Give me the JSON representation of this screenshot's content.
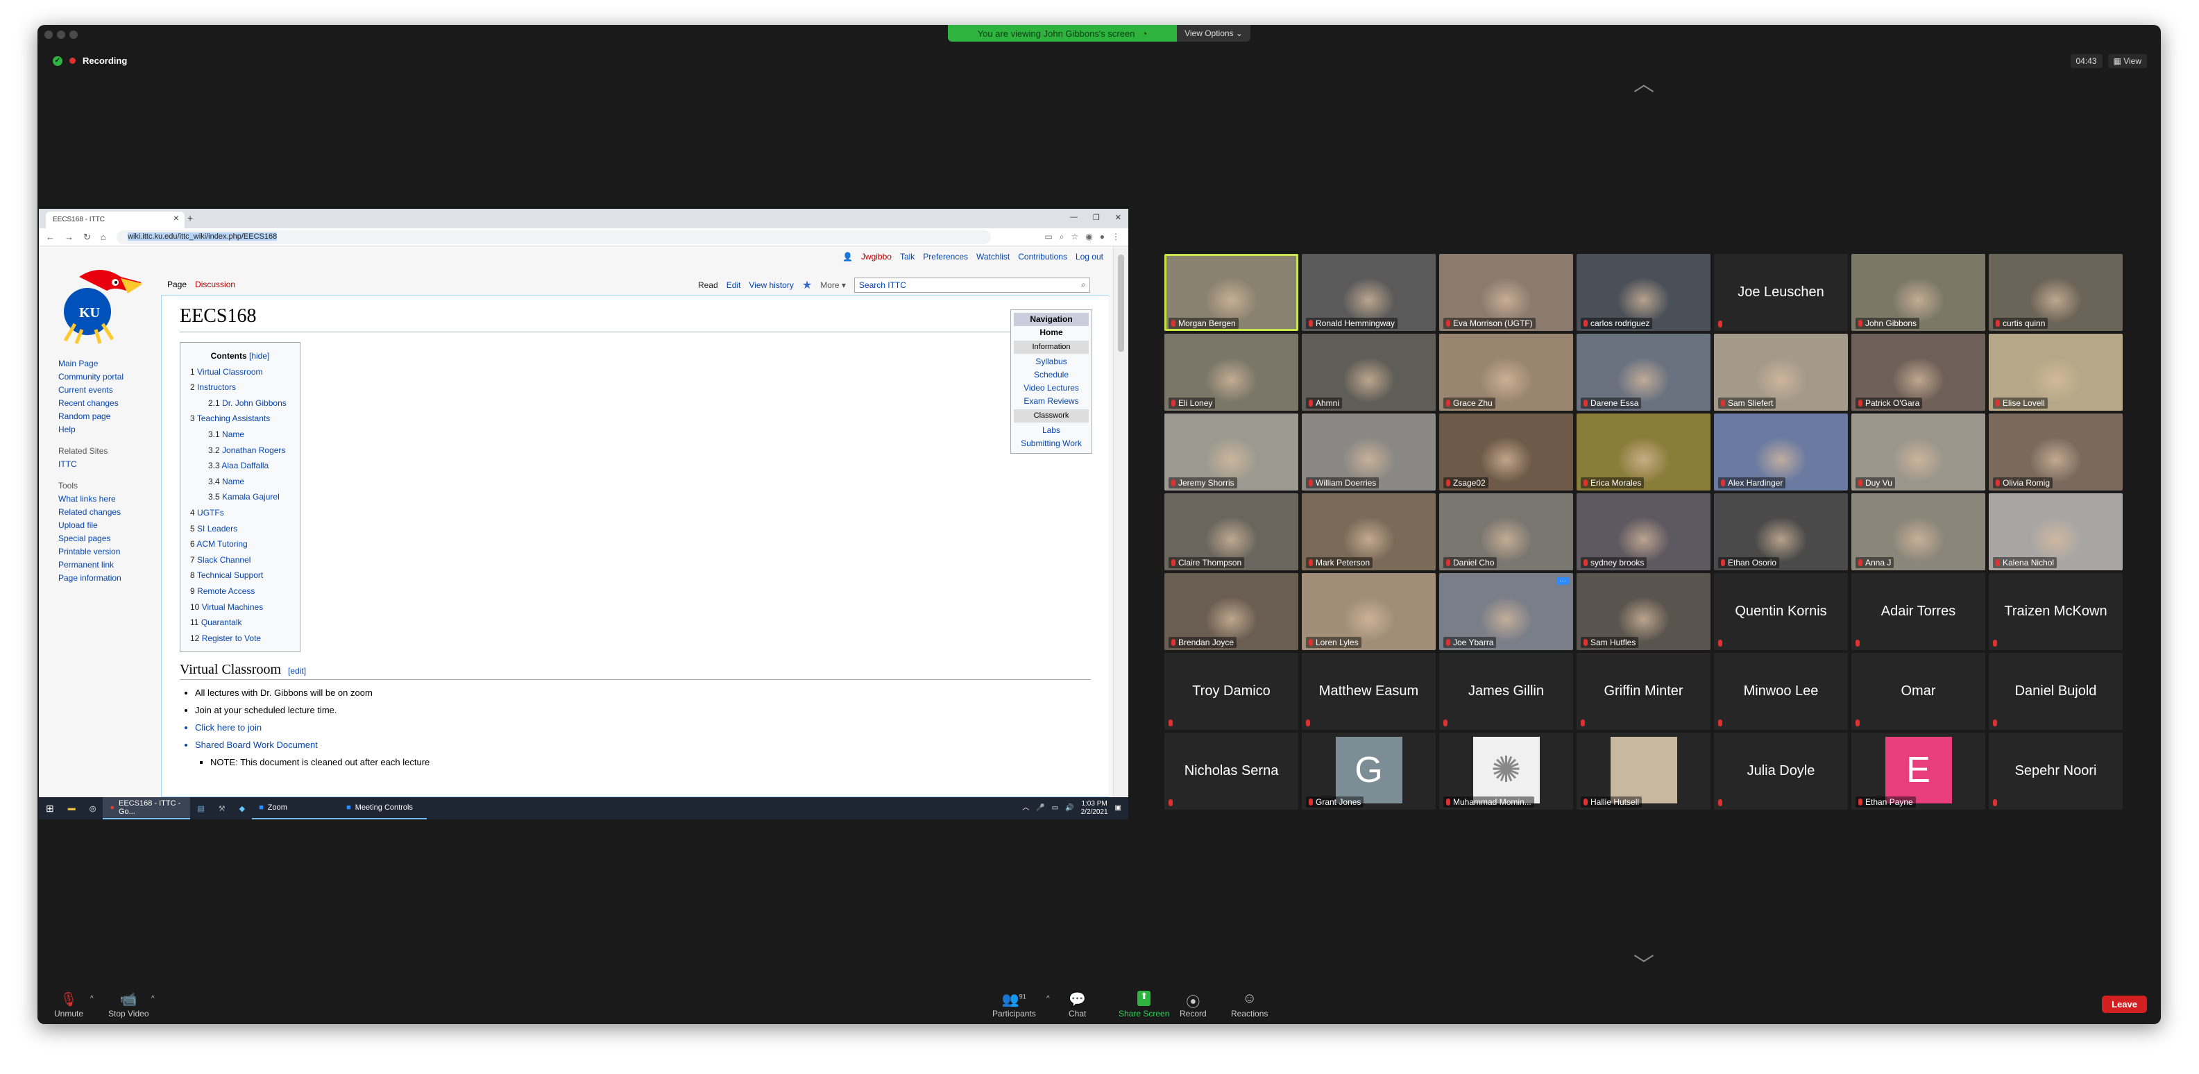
{
  "banner": {
    "viewing": "You are viewing John Gibbons's screen",
    "view_options": "View Options ⌄"
  },
  "recording": "Recording",
  "timer": "04:43",
  "view_btn": "View",
  "browser": {
    "tab_title": "EECS168 - ITTC",
    "url_display": "wiki.ittc.ku.edu/ittc_wiki/index.php/EECS168"
  },
  "wiki": {
    "personal": [
      "Jwgibbo",
      "Talk",
      "Preferences",
      "Watchlist",
      "Contributions",
      "Log out"
    ],
    "tabs_left": [
      "Page",
      "Discussion"
    ],
    "tabs_right": [
      "Read",
      "Edit",
      "View history",
      "More ▾"
    ],
    "search_placeholder": "Search ITTC",
    "sidebar": {
      "main": [
        "Main Page",
        "Community portal",
        "Current events",
        "Recent changes",
        "Random page",
        "Help"
      ],
      "related_heading": "Related Sites",
      "related": [
        "ITTC"
      ],
      "tools_heading": "Tools",
      "tools": [
        "What links here",
        "Related changes",
        "Upload file",
        "Special pages",
        "Printable version",
        "Permanent link",
        "Page information"
      ]
    },
    "title": "EECS168",
    "toc_title": "Contents",
    "toc_hide": "[hide]",
    "toc": [
      {
        "n": "1",
        "t": "Virtual Classroom",
        "sub": false
      },
      {
        "n": "2",
        "t": "Instructors",
        "sub": false
      },
      {
        "n": "2.1",
        "t": "Dr. John Gibbons",
        "sub": true
      },
      {
        "n": "3",
        "t": "Teaching Assistants",
        "sub": false
      },
      {
        "n": "3.1",
        "t": "Name",
        "sub": true
      },
      {
        "n": "3.2",
        "t": "Jonathan Rogers",
        "sub": true
      },
      {
        "n": "3.3",
        "t": "Alaa Daffalla",
        "sub": true
      },
      {
        "n": "3.4",
        "t": "Name",
        "sub": true
      },
      {
        "n": "3.5",
        "t": "Kamala Gajurel",
        "sub": true
      },
      {
        "n": "4",
        "t": "UGTFs",
        "sub": false
      },
      {
        "n": "5",
        "t": "SI Leaders",
        "sub": false
      },
      {
        "n": "6",
        "t": "ACM Tutoring",
        "sub": false
      },
      {
        "n": "7",
        "t": "Slack Channel",
        "sub": false
      },
      {
        "n": "8",
        "t": "Technical Support",
        "sub": false
      },
      {
        "n": "9",
        "t": "Remote Access",
        "sub": false
      },
      {
        "n": "10",
        "t": "Virtual Machines",
        "sub": false
      },
      {
        "n": "11",
        "t": "Quarantalk",
        "sub": false
      },
      {
        "n": "12",
        "t": "Register to Vote",
        "sub": false
      }
    ],
    "navbox": {
      "title": "Navigation",
      "home": "Home",
      "info": "Information",
      "links1": [
        "Syllabus",
        "Schedule",
        "Video Lectures",
        "Exam Reviews"
      ],
      "classwork": "Classwork",
      "links2": [
        "Labs",
        "Submitting Work"
      ]
    },
    "section_title": "Virtual Classroom",
    "section_edit": "[edit]",
    "bullets": [
      {
        "t": "All lectures with Dr. Gibbons will be on zoom",
        "link": false
      },
      {
        "t": "Join at your scheduled lecture time.",
        "link": false
      },
      {
        "t": "Click here to join",
        "link": true
      },
      {
        "t": "Shared Board Work Document",
        "link": true
      }
    ],
    "note": "NOTE: This document is cleaned out after each lecture"
  },
  "taskbar": {
    "chrome_task": "EECS168 - ITTC - Go...",
    "zoom_task": "Zoom",
    "meeting_task": "Meeting Controls",
    "time": "1:03 PM",
    "date": "2/2/2021"
  },
  "participants_grid": [
    {
      "name": "Morgan Bergen",
      "type": "video",
      "speaking": true,
      "bg": "#8a8270"
    },
    {
      "name": "Ronald Hemmingway",
      "type": "video",
      "bg": "#5a5a5a"
    },
    {
      "name": "Eva Morrison (UGTF)",
      "type": "video",
      "bg": "#8b7a6e"
    },
    {
      "name": "carlos rodriguez",
      "type": "video",
      "bg": "#4a5058"
    },
    {
      "name": "Joe Leuschen",
      "type": "name"
    },
    {
      "name": "John Gibbons",
      "type": "video",
      "bg": "#7b7868"
    },
    {
      "name": "curtis quinn",
      "type": "video",
      "bg": "#6b6458"
    },
    {
      "name": "Eli Loney",
      "type": "video",
      "bg": "#7a7668"
    },
    {
      "name": "Ahmni",
      "type": "video",
      "bg": "#5f5d57"
    },
    {
      "name": "Grace Zhu",
      "type": "video",
      "bg": "#9a8670"
    },
    {
      "name": "Darene Essa",
      "type": "video",
      "bg": "#6a7280"
    },
    {
      "name": "Sam Sliefert",
      "type": "video",
      "bg": "#a39a8a"
    },
    {
      "name": "Patrick O'Gara",
      "type": "video",
      "bg": "#6e6058"
    },
    {
      "name": "Elise Lovell",
      "type": "video",
      "bg": "#b5a888"
    },
    {
      "name": "Jeremy Shorris",
      "type": "video",
      "bg": "#9c9a90"
    },
    {
      "name": "William Doerries",
      "type": "video",
      "bg": "#8a8884"
    },
    {
      "name": "Zsage02",
      "type": "video",
      "bg": "#6e5a48"
    },
    {
      "name": "Erica Morales",
      "type": "video",
      "bg": "#8a7d3a"
    },
    {
      "name": "Alex Hardinger",
      "type": "video",
      "bg": "#6a7aa0"
    },
    {
      "name": "Duy Vu",
      "type": "video",
      "bg": "#9a968c"
    },
    {
      "name": "Olivia Romig",
      "type": "video",
      "bg": "#7a6a5e"
    },
    {
      "name": "Claire Thompson",
      "type": "video",
      "bg": "#6a665e"
    },
    {
      "name": "Mark Peterson",
      "type": "video",
      "bg": "#7a6a58"
    },
    {
      "name": "Daniel Cho",
      "type": "video",
      "bg": "#7a7670"
    },
    {
      "name": "sydney brooks",
      "type": "video",
      "bg": "#5e5860"
    },
    {
      "name": "Ethan Osorio",
      "type": "video",
      "bg": "#4a4a4a"
    },
    {
      "name": "Anna J",
      "type": "video",
      "bg": "#8a867a"
    },
    {
      "name": "Kalena Nichol",
      "type": "video",
      "bg": "#a8a6a4"
    },
    {
      "name": "Brendan Joyce",
      "type": "video",
      "bg": "#6a5e52"
    },
    {
      "name": "Loren Lyles",
      "type": "video",
      "bg": "#a08e78"
    },
    {
      "name": "Joe Ybarra",
      "type": "video",
      "bg": "#7a7e88",
      "more": "···"
    },
    {
      "name": "Sam Hutfles",
      "type": "video",
      "bg": "#5a544e"
    },
    {
      "name": "Quentin Kornis",
      "type": "name"
    },
    {
      "name": "Adair Torres",
      "type": "name"
    },
    {
      "name": "Traizen McKown",
      "type": "name"
    },
    {
      "name": "Troy Damico",
      "type": "name"
    },
    {
      "name": "Matthew Easum",
      "type": "name"
    },
    {
      "name": "James Gillin",
      "type": "name"
    },
    {
      "name": "Griffin Minter",
      "type": "name"
    },
    {
      "name": "Minwoo Lee",
      "type": "name"
    },
    {
      "name": "Omar",
      "type": "name"
    },
    {
      "name": "Daniel Bujold",
      "type": "name"
    },
    {
      "name": "Nicholas Serna",
      "type": "name"
    },
    {
      "name": "Grant Jones",
      "type": "avatar",
      "letter": "G",
      "avbg": "#7d8d96"
    },
    {
      "name": "Muhammad Momin...",
      "type": "avatar",
      "letter": "✺",
      "avbg": "#f0f0f0",
      "avfg": "#888"
    },
    {
      "name": "Hallie Hutsell",
      "type": "avatar",
      "letter": "",
      "avbg": "#c8b8a0"
    },
    {
      "name": "Julia Doyle",
      "type": "name"
    },
    {
      "name": "Ethan Payne",
      "type": "avatar",
      "letter": "E",
      "avbg": "#e83e7a"
    },
    {
      "name": "Sepehr Noori",
      "type": "name"
    }
  ],
  "controls": {
    "unmute": "Unmute",
    "stop_video": "Stop Video",
    "participants": "Participants",
    "participant_count": "91",
    "chat": "Chat",
    "share": "Share Screen",
    "record": "Record",
    "reactions": "Reactions",
    "leave": "Leave"
  }
}
